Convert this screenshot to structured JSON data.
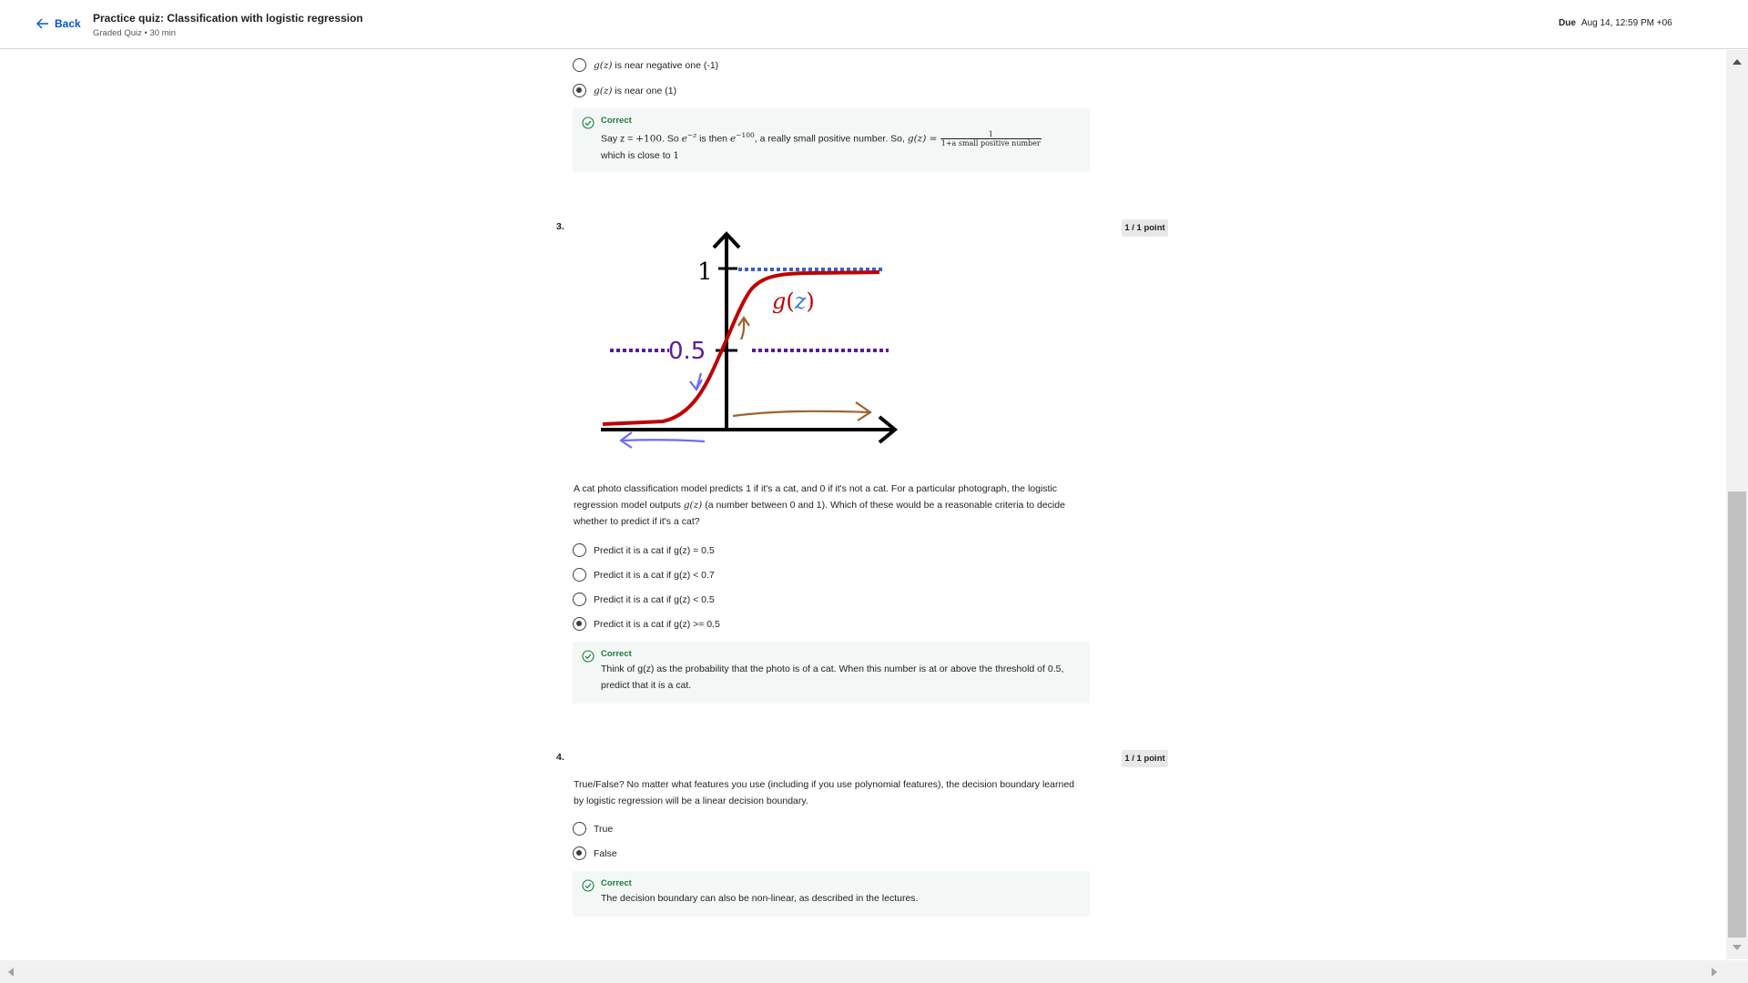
{
  "header": {
    "back_label": "Back",
    "title": "Practice quiz: Classification with logistic regression",
    "subtitle": "Graded Quiz • 30 min",
    "due_label": "Due",
    "due_date": "Aug 14, 12:59 PM +06"
  },
  "q2": {
    "options": [
      {
        "pre": "g(z)",
        "text": " is near negative one (-1)",
        "selected": false
      },
      {
        "pre": "g(z)",
        "text": " is near one (1)",
        "selected": true
      }
    ],
    "feedback": {
      "title": "Correct",
      "t1": "Say z = ",
      "m1": "+100",
      "t2": ". So ",
      "m2": "e",
      "m2sup": "−z",
      "t3": " is then ",
      "m3": "e",
      "m3sup": "−100",
      "t4": ", a really small positive number. So, ",
      "m4": "g(z) = ",
      "frac_num": "1",
      "frac_den": "1+a small positive number",
      "t5": "which is close to ",
      "m5": "1"
    }
  },
  "q3": {
    "number": "3.",
    "points": "1 / 1 point",
    "figure": {
      "label_one": "1",
      "label_half": "0.5",
      "label_g": "g",
      "label_z": "z",
      "colors": {
        "curve": "#c00000",
        "top_dash": "#3a5fcd",
        "mid_dash": "#5b1a9c",
        "arrow_blue": "#6b6bff",
        "arrow_brown": "#a0622d"
      }
    },
    "text_a": "A cat photo classification model predicts 1 if it's a cat, and 0 if it's not a cat. For a particular photograph, the logistic regression model outputs ",
    "text_m": "g(z)",
    "text_b": " (a number between 0 and 1). Which of these would be a reasonable criteria to decide whether to predict if it's a cat?",
    "options": [
      {
        "text": "Predict it is a cat if g(z) = 0.5",
        "selected": false
      },
      {
        "text": "Predict it is a cat if g(z) < 0.7",
        "selected": false
      },
      {
        "text": "Predict it is a cat if g(z) < 0.5",
        "selected": false
      },
      {
        "text": "Predict it is a cat if g(z) >= 0.5",
        "selected": true
      }
    ],
    "feedback": {
      "title": "Correct",
      "text": "Think of g(z) as the probability that the photo is of a cat. When this number is at or above the threshold of 0.5, predict that it is a cat."
    }
  },
  "q4": {
    "number": "4.",
    "points": "1 / 1 point",
    "text": "True/False? No matter what features you use (including if you use polynomial features), the decision boundary learned by logistic regression will be a linear decision boundary.",
    "options": [
      {
        "text": "True",
        "selected": false
      },
      {
        "text": "False",
        "selected": true
      }
    ],
    "feedback": {
      "title": "Correct",
      "text": "The decision boundary can also be non-linear, as described in the lectures."
    }
  }
}
